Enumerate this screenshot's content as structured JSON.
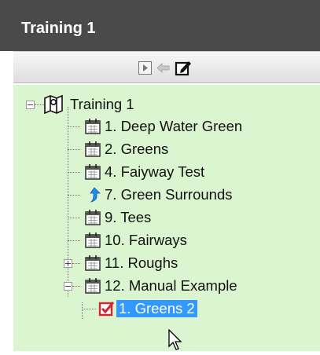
{
  "panel": {
    "title": "Training 1"
  },
  "toolbar": {
    "buttons": [
      {
        "name": "play-icon"
      },
      {
        "name": "arrow-left-icon"
      },
      {
        "name": "edit-icon"
      }
    ]
  },
  "tree": {
    "root": {
      "label": "Training 1",
      "icon": "map-icon",
      "expanded": true
    },
    "items": [
      {
        "label": "1. Deep Water Green",
        "icon": "calendar-icon"
      },
      {
        "label": "2. Greens",
        "icon": "calendar-icon"
      },
      {
        "label": "4. Faiyway Test",
        "icon": "calendar-icon"
      },
      {
        "label": "7. Green Surrounds",
        "icon": "arrow-up-icon"
      },
      {
        "label": "9. Tees",
        "icon": "calendar-icon"
      },
      {
        "label": "10. Fairways",
        "icon": "calendar-icon"
      },
      {
        "label": "11. Roughs",
        "icon": "calendar-icon",
        "expander": "collapsed"
      },
      {
        "label": "12. Manual Example",
        "icon": "calendar-icon",
        "expander": "expanded",
        "children": [
          {
            "label": "1. Greens 2",
            "icon": "checkbox-checked-icon",
            "selected": true
          }
        ]
      }
    ]
  },
  "colors": {
    "title_bg": "#4a4a4a",
    "tree_bg": "#dbf5d1",
    "selection": "#3399ff",
    "check": "#d9242c"
  }
}
